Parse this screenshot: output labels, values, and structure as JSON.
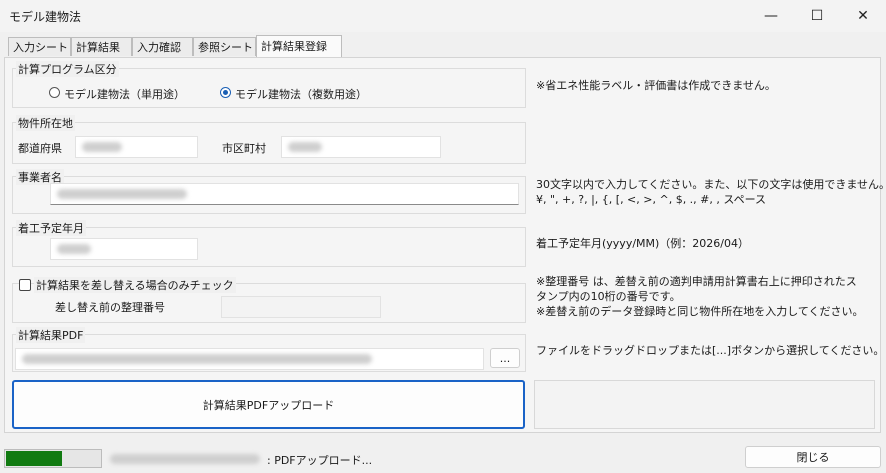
{
  "window": {
    "title": "モデル建物法",
    "minimize_glyph": "—",
    "maximize_glyph": "☐",
    "close_glyph": "✕"
  },
  "tabs": [
    {
      "label": "入力シート",
      "active": false
    },
    {
      "label": "計算結果",
      "active": false
    },
    {
      "label": "入力確認",
      "active": false
    },
    {
      "label": "参照シート",
      "active": false
    },
    {
      "label": "計算結果登録",
      "active": true
    }
  ],
  "program_group": {
    "label": "計算プログラム区分",
    "options": [
      {
        "label": "モデル建物法（単用途）",
        "selected": false
      },
      {
        "label": "モデル建物法（複数用途）",
        "selected": true
      }
    ],
    "note": "※省エネ性能ラベル・評価書は作成できません。"
  },
  "location_group": {
    "label": "物件所在地",
    "prefecture_label": "都道府県",
    "prefecture_value": "",
    "city_label": "市区町村",
    "city_value": ""
  },
  "business_group": {
    "label": "事業者名",
    "value": "",
    "note_line1": "30文字以内で入力してください。また、以下の文字は使用できません。",
    "note_line2": "¥, \", +, ?, |, {, [, <, >, ^, $, ., #, , スペース"
  },
  "start_group": {
    "label": "着工予定年月",
    "value": "",
    "note": "着工予定年月(yyyy/MM)（例：2026/04）"
  },
  "replace_group": {
    "checkbox_label": "計算結果を差し替える場合のみチェック",
    "checked": false,
    "number_label": "差し替え前の整理番号",
    "number_value": "",
    "note_line1": "※整理番号 は、差替え前の適判申請用計算書右上に押印されたス",
    "note_line2": "タンプ内の10桁の番号です。",
    "note_line3": "※差替え前のデータ登録時と同じ物件所在地を入力してください。"
  },
  "pdf_group": {
    "label": "計算結果PDF",
    "path_value": "",
    "browse_label": "...",
    "note": "ファイルをドラッグドロップまたは[...]ボタンから選択してください。"
  },
  "upload_button_label": "計算結果PDFアップロード",
  "status": {
    "progress_percent": 60,
    "filename": "",
    "message": ": PDFアップロード...",
    "close_label": "閉じる"
  },
  "colors": {
    "accent": "#1a63c7",
    "progress": "#117a11"
  }
}
